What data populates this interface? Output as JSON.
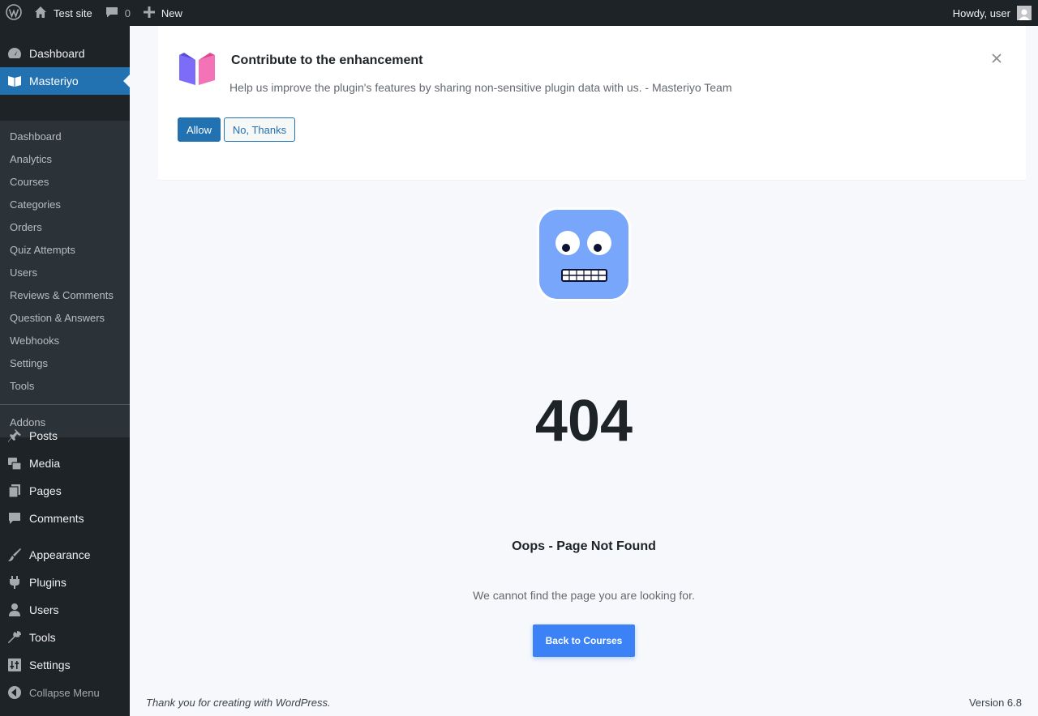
{
  "adminbar": {
    "site_name": "Test site",
    "comments_count": "0",
    "new_label": "New",
    "howdy": "Howdy, user",
    "icons": [
      "wordpress-logo-icon",
      "home-icon",
      "comment-bubble-icon",
      "plus-icon",
      "avatar-icon"
    ]
  },
  "sidebar": {
    "top_items": [
      {
        "label": "Dashboard",
        "icon": "dashboard-gauge-icon"
      },
      {
        "label": "Masteriyo",
        "icon": "masteriyo-book-icon",
        "current": true
      },
      {
        "label": "Posts",
        "icon": "pushpin-icon"
      },
      {
        "label": "Media",
        "icon": "media-icon"
      },
      {
        "label": "Pages",
        "icon": "pages-icon"
      },
      {
        "label": "Comments",
        "icon": "comments-icon"
      },
      {
        "label": "Appearance",
        "icon": "paintbrush-icon"
      },
      {
        "label": "Plugins",
        "icon": "plugin-icon"
      },
      {
        "label": "Users",
        "icon": "user-icon"
      },
      {
        "label": "Tools",
        "icon": "wrench-icon"
      },
      {
        "label": "Settings",
        "icon": "settings-sliders-icon"
      }
    ],
    "submenu": [
      "Dashboard",
      "Analytics",
      "Courses",
      "Categories",
      "Orders",
      "Quiz Attempts",
      "Users",
      "Reviews & Comments",
      "Question & Answers",
      "Webhooks",
      "Settings",
      "Tools"
    ],
    "addons_label": "Addons",
    "collapse_label": "Collapse Menu"
  },
  "notice": {
    "title": "Contribute to the enhancement",
    "text": "Help us improve the plugin's features by sharing non-sensitive plugin data with us. - Masteriyo Team",
    "allow_label": "Allow",
    "no_thanks_label": "No, Thanks"
  },
  "error": {
    "code": "404",
    "title": "Oops - Page Not Found",
    "message": "We cannot find the page you are looking for.",
    "back_label": "Back to Courses"
  },
  "footer": {
    "thanks_prefix": "Thank you for creating with ",
    "thanks_link": "WordPress",
    "thanks_suffix": ".",
    "version": "Version 6.8"
  },
  "colors": {
    "admin_dark": "#1d2327",
    "wp_blue": "#2271b1",
    "back_button": "#3b82f6",
    "robot_face": "#78a6fb"
  }
}
